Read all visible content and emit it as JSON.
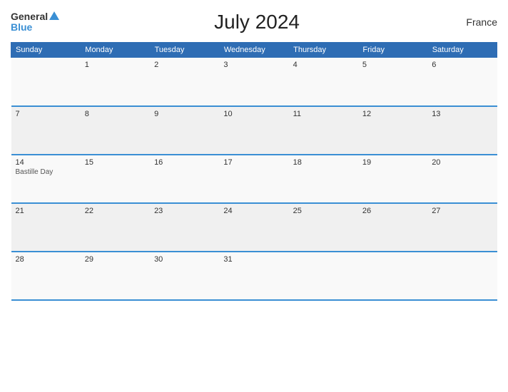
{
  "header": {
    "title": "July 2024",
    "country": "France",
    "logo_general": "General",
    "logo_blue": "Blue"
  },
  "weekdays": [
    "Sunday",
    "Monday",
    "Tuesday",
    "Wednesday",
    "Thursday",
    "Friday",
    "Saturday"
  ],
  "weeks": [
    [
      {
        "day": "",
        "event": ""
      },
      {
        "day": "1",
        "event": ""
      },
      {
        "day": "2",
        "event": ""
      },
      {
        "day": "3",
        "event": ""
      },
      {
        "day": "4",
        "event": ""
      },
      {
        "day": "5",
        "event": ""
      },
      {
        "day": "6",
        "event": ""
      }
    ],
    [
      {
        "day": "7",
        "event": ""
      },
      {
        "day": "8",
        "event": ""
      },
      {
        "day": "9",
        "event": ""
      },
      {
        "day": "10",
        "event": ""
      },
      {
        "day": "11",
        "event": ""
      },
      {
        "day": "12",
        "event": ""
      },
      {
        "day": "13",
        "event": ""
      }
    ],
    [
      {
        "day": "14",
        "event": "Bastille Day"
      },
      {
        "day": "15",
        "event": ""
      },
      {
        "day": "16",
        "event": ""
      },
      {
        "day": "17",
        "event": ""
      },
      {
        "day": "18",
        "event": ""
      },
      {
        "day": "19",
        "event": ""
      },
      {
        "day": "20",
        "event": ""
      }
    ],
    [
      {
        "day": "21",
        "event": ""
      },
      {
        "day": "22",
        "event": ""
      },
      {
        "day": "23",
        "event": ""
      },
      {
        "day": "24",
        "event": ""
      },
      {
        "day": "25",
        "event": ""
      },
      {
        "day": "26",
        "event": ""
      },
      {
        "day": "27",
        "event": ""
      }
    ],
    [
      {
        "day": "28",
        "event": ""
      },
      {
        "day": "29",
        "event": ""
      },
      {
        "day": "30",
        "event": ""
      },
      {
        "day": "31",
        "event": ""
      },
      {
        "day": "",
        "event": ""
      },
      {
        "day": "",
        "event": ""
      },
      {
        "day": "",
        "event": ""
      }
    ]
  ]
}
